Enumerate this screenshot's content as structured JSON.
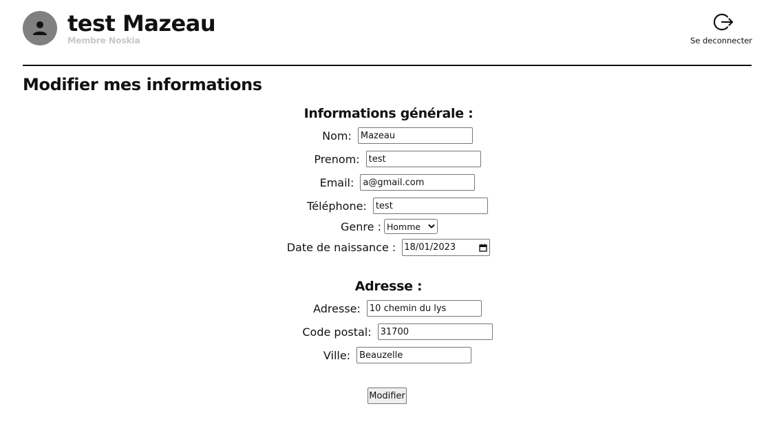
{
  "header": {
    "user_name": "test Mazeau",
    "user_role": "Membre Noskia",
    "logout_label": "Se deconnecter"
  },
  "page": {
    "title": "Modifier mes informations"
  },
  "general": {
    "section_title": "Informations générale :",
    "nom": {
      "label": "Nom:",
      "value": "Mazeau"
    },
    "prenom": {
      "label": "Prenom:",
      "value": "test"
    },
    "email": {
      "label": "Email:",
      "value": "a@gmail.com"
    },
    "telephone": {
      "label": "Téléphone:",
      "value": "test"
    },
    "genre": {
      "label": "Genre :",
      "value": "Homme"
    },
    "naissance": {
      "label": "Date de naissance :",
      "value": "18/01/2023"
    }
  },
  "address": {
    "section_title": "Adresse :",
    "adresse": {
      "label": "Adresse:",
      "value": "10 chemin du lys"
    },
    "code_postal": {
      "label": "Code postal:",
      "value": "31700"
    },
    "ville": {
      "label": "Ville:",
      "value": "Beauzelle"
    }
  },
  "form": {
    "submit_label": "Modifier"
  },
  "icons": {
    "avatar": "person-icon",
    "logout": "logout-icon",
    "select": "chevron-down-icon",
    "date": "calendar-icon"
  },
  "colors": {
    "avatar_bg": "#808080",
    "role_text": "#c8c8c8",
    "divider": "#111111"
  }
}
